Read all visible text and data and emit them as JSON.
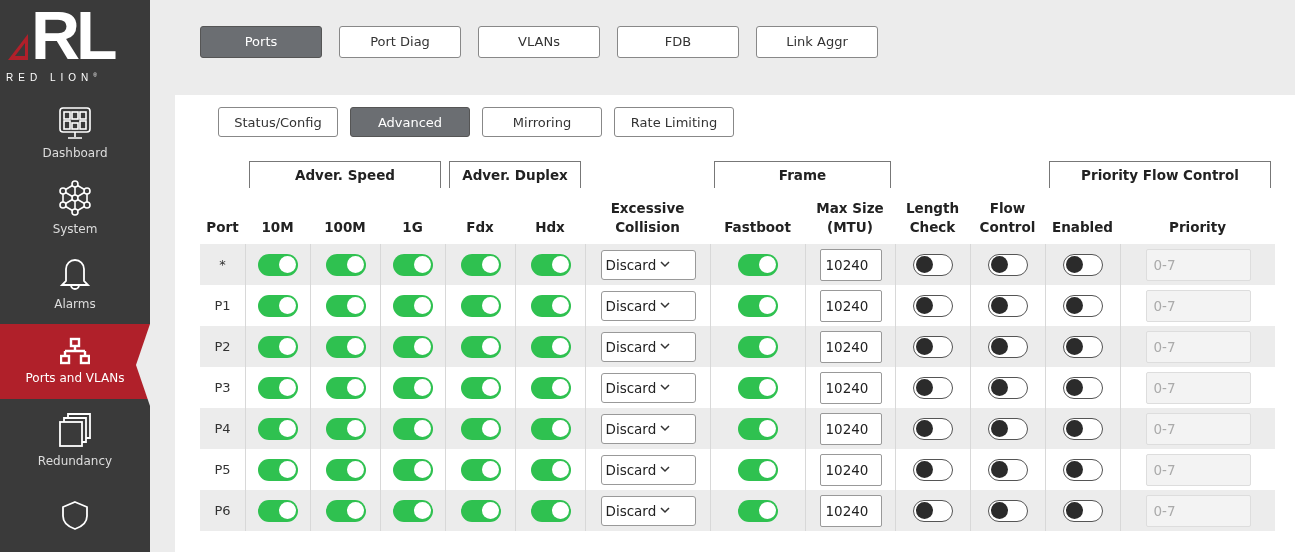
{
  "logo": {
    "mark": "RL",
    "name": "RED LION$^{®}$"
  },
  "sidebar": {
    "items": [
      {
        "label": "Dashboard",
        "selected": false
      },
      {
        "label": "System",
        "selected": false
      },
      {
        "label": "Alarms",
        "selected": false
      },
      {
        "label": "Ports and VLANs",
        "selected": true
      },
      {
        "label": "Redundancy",
        "selected": false
      },
      {
        "selected": false
      }
    ]
  },
  "tabs": [
    {
      "label": "Ports",
      "selected": true
    },
    {
      "label": "Port Diag",
      "selected": false
    },
    {
      "label": "VLANs",
      "selected": false
    },
    {
      "label": "FDB",
      "selected": false
    },
    {
      "label": "Link Aggr",
      "selected": false
    }
  ],
  "subtabs": [
    {
      "label": "Status/Config",
      "selected": false
    },
    {
      "label": "Advanced",
      "selected": true
    },
    {
      "label": "Mirroring",
      "selected": false
    },
    {
      "label": "Rate Limiting",
      "selected": false
    }
  ],
  "table": {
    "groups": [
      "Adver. Speed",
      "Adver. Duplex",
      "Frame",
      "Priority Flow Control"
    ],
    "columns": [
      [
        "Port"
      ],
      [
        "10M"
      ],
      [
        "100M"
      ],
      [
        "1G"
      ],
      [
        "Fdx"
      ],
      [
        "Hdx"
      ],
      [
        "Excessive",
        "Collision"
      ],
      [
        "Fastboot"
      ],
      [
        "Max Size",
        "(MTU)"
      ],
      [
        "Length",
        "Check"
      ],
      [
        "Flow",
        "Control"
      ],
      [
        "Enabled"
      ],
      [
        "Priority"
      ]
    ],
    "rows": [
      {
        "port": "*",
        "speed_10m": true,
        "speed_100m": true,
        "speed_1g": true,
        "fdx": true,
        "hdx": true,
        "excessive_collision": "Discard",
        "fastboot": true,
        "max_size": "10240",
        "length_check": false,
        "flow_control": false,
        "pfc_enabled": false,
        "priority": {
          "placeholder": "0-7",
          "disabled": true
        }
      },
      {
        "port": "P1",
        "speed_10m": true,
        "speed_100m": true,
        "speed_1g": true,
        "fdx": true,
        "hdx": true,
        "excessive_collision": "Discard",
        "fastboot": true,
        "max_size": "10240",
        "length_check": false,
        "flow_control": false,
        "pfc_enabled": false,
        "priority": {
          "placeholder": "0-7",
          "disabled": true
        }
      },
      {
        "port": "P2",
        "speed_10m": true,
        "speed_100m": true,
        "speed_1g": true,
        "fdx": true,
        "hdx": true,
        "excessive_collision": "Discard",
        "fastboot": true,
        "max_size": "10240",
        "length_check": false,
        "flow_control": false,
        "pfc_enabled": false,
        "priority": {
          "placeholder": "0-7",
          "disabled": true
        }
      },
      {
        "port": "P3",
        "speed_10m": true,
        "speed_100m": true,
        "speed_1g": true,
        "fdx": true,
        "hdx": true,
        "excessive_collision": "Discard",
        "fastboot": true,
        "max_size": "10240",
        "length_check": false,
        "flow_control": false,
        "pfc_enabled": false,
        "priority": {
          "placeholder": "0-7",
          "disabled": true
        }
      },
      {
        "port": "P4",
        "speed_10m": true,
        "speed_100m": true,
        "speed_1g": true,
        "fdx": true,
        "hdx": true,
        "excessive_collision": "Discard",
        "fastboot": true,
        "max_size": "10240",
        "length_check": false,
        "flow_control": false,
        "pfc_enabled": false,
        "priority": {
          "placeholder": "0-7",
          "disabled": true
        }
      },
      {
        "port": "P5",
        "speed_10m": true,
        "speed_100m": true,
        "speed_1g": true,
        "fdx": true,
        "hdx": true,
        "excessive_collision": "Discard",
        "fastboot": true,
        "max_size": "10240",
        "length_check": false,
        "flow_control": false,
        "pfc_enabled": false,
        "priority": {
          "placeholder": "0-7",
          "disabled": true
        }
      },
      {
        "port": "P6",
        "speed_10m": true,
        "speed_100m": true,
        "speed_1g": true,
        "fdx": true,
        "hdx": true,
        "excessive_collision": "Discard",
        "fastboot": true,
        "max_size": "10240",
        "length_check": false,
        "flow_control": false,
        "pfc_enabled": false,
        "priority": {
          "placeholder": "0-7",
          "disabled": true
        }
      }
    ]
  }
}
